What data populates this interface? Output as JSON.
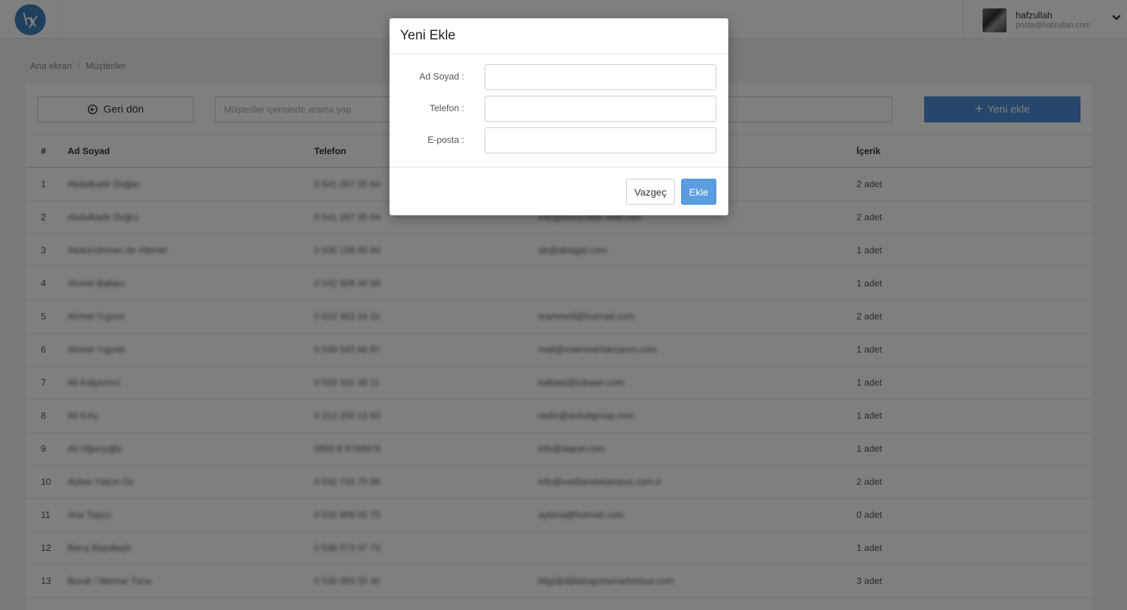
{
  "header": {
    "user": {
      "name": "hafzullah",
      "email": "posta@hafzullah.com"
    }
  },
  "breadcrumb": {
    "home": "Ana ekran",
    "separator": "/",
    "current": "Müşteriler"
  },
  "toolbar": {
    "back_label": "Geri dön",
    "search_placeholder": "Müşteriler içerisinde arama yap",
    "add_label": "Yeni ekle"
  },
  "table": {
    "headers": [
      "#",
      "Ad Soyad",
      "Telefon",
      "",
      "İçerik"
    ],
    "rows": [
      {
        "num": "1",
        "name": "Abdulkadir Doğan",
        "phone": "0 541 267 35 64",
        "email": "",
        "content": "2 adet"
      },
      {
        "num": "2",
        "name": "Abdulkadir Doğru",
        "phone": "0 541 267 35 64",
        "email": "info@tescicatbir.web.com",
        "content": "2 adet"
      },
      {
        "num": "3",
        "name": "Abdurrahman de Hikmet",
        "phone": "0 530 158 95 84",
        "email": "ab@ablagal.com",
        "content": "1 adet"
      },
      {
        "num": "4",
        "name": "Ahmet Baltacı",
        "phone": "0 542 308 46 58",
        "email": "",
        "content": "1 adet"
      },
      {
        "num": "5",
        "name": "Ahmet Yıgınız",
        "phone": "0 532 363 34 31",
        "email": "teamnerll@hotmail.com",
        "content": "2 adet"
      },
      {
        "num": "6",
        "name": "Ahmet Yıgıralı",
        "phone": "0 539 345 66 87",
        "email": "mail@mainmarildesarım.com",
        "content": "1 adet"
      },
      {
        "num": "7",
        "name": "Ali Kalpsımız",
        "phone": "0 533 331 48 11",
        "email": "kalbaal@tubaan.com",
        "content": "1 adet"
      },
      {
        "num": "8",
        "name": "Ali Kılıç",
        "phone": "0 212 250 13 93",
        "email": "radio@ardudgroup.com",
        "content": "1 adet"
      },
      {
        "num": "9",
        "name": "Ali Uğurçuğlu",
        "phone": "0850 8 9768979",
        "email": "info@aqeat.com",
        "content": "1 adet"
      },
      {
        "num": "10",
        "name": "Aylian Yalçın Öz",
        "phone": "0 532 733 75 88",
        "email": "info@vadilandekampus.com.tr",
        "content": "2 adet"
      },
      {
        "num": "11",
        "name": "Ana Topçu",
        "phone": "0 532 956 02 75",
        "email": "aylana@hotmail.com",
        "content": "0 adet"
      },
      {
        "num": "12",
        "name": "Barış Başaltaşlı",
        "phone": "0 536 573 47 73",
        "email": "",
        "content": "1 adet"
      },
      {
        "num": "13",
        "name": "Burak / Mernar Tuna",
        "phone": "0 530 393 35 40",
        "email": "bilgi@dijitalsigortamarketsus.com",
        "content": "3 adet"
      }
    ]
  },
  "modal": {
    "title": "Yeni Ekle",
    "fields": [
      {
        "label": "Ad Soyad :",
        "value": ""
      },
      {
        "label": "Telefon :",
        "value": ""
      },
      {
        "label": "E-posta :",
        "value": ""
      }
    ],
    "cancel_label": "Vazgeç",
    "submit_label": "Ekle"
  },
  "colors": {
    "brand": "#3f7fbf",
    "primary_button": "#4c8dd6",
    "modal_submit": "#5a9de0"
  },
  "icons": {
    "logo": "brand-logo-icon",
    "back": "arrow-circle-left-icon",
    "add": "plus-icon",
    "user_menu": "chevron-down-icon"
  }
}
